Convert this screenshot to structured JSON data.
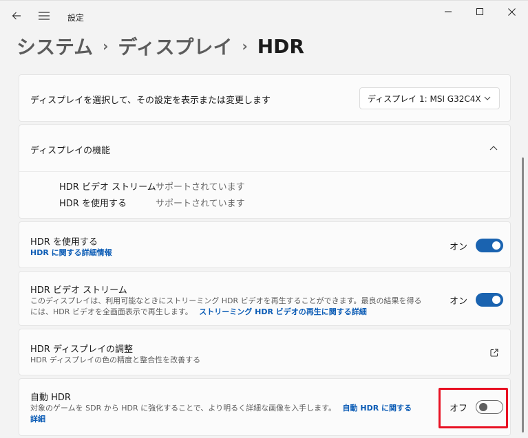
{
  "titlebar": {
    "app_title": "設定"
  },
  "breadcrumb": {
    "items": [
      "システム",
      "ディスプレイ"
    ],
    "current": "HDR"
  },
  "select_display": {
    "label": "ディスプレイを選択して、その設定を表示または変更します",
    "selected": "ディスプレイ 1: MSI G32C4X"
  },
  "capabilities": {
    "title": "ディスプレイの機能",
    "rows": [
      {
        "key": "HDR ビデオ ストリーム",
        "value": "サポートされています"
      },
      {
        "key": "HDR を使用する",
        "value": "サポートされています"
      }
    ]
  },
  "use_hdr": {
    "title": "HDR を使用する",
    "link": "HDR に関する詳細情報",
    "state_label": "オン",
    "state": true
  },
  "hdr_video": {
    "title": "HDR ビデオ ストリーム",
    "desc_line1": "このディスプレイは、利用可能なときにストリーミング HDR ビデオを再生することができます。最良の結果を得る",
    "desc_line2": "には、HDR ビデオを全画面表示で再生します。",
    "link": "ストリーミング HDR ビデオの再生に関する詳細",
    "state_label": "オン",
    "state": true
  },
  "calibration": {
    "title": "HDR ディスプレイの調整",
    "desc": "HDR ディスプレイの色の精度と整合性を改善する"
  },
  "auto_hdr": {
    "title": "自動 HDR",
    "desc": "対象のゲームを SDR から HDR に強化することで、より明るく詳細な画像を入手します。",
    "link_part1": "自動 HDR に関する",
    "link_part2": "詳細",
    "state_label": "オフ",
    "state": false
  },
  "colors": {
    "accent": "#1a63b0",
    "link": "#0a5bb5",
    "highlight": "#e81123"
  },
  "icons": {
    "back": "back-arrow-icon",
    "menu": "hamburger-icon",
    "minimize": "minimize-icon",
    "maximize": "maximize-icon",
    "close": "close-icon",
    "chevron_down": "chevron-down-icon",
    "chevron_up": "chevron-up-icon",
    "external": "external-link-icon"
  }
}
